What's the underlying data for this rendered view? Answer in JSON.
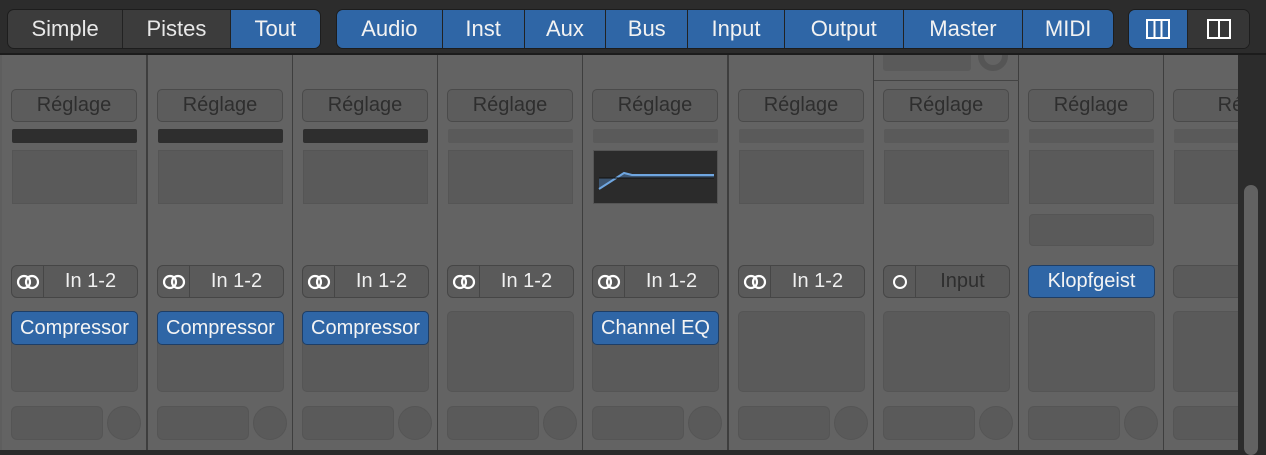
{
  "view_modes": [
    {
      "label": "Simple",
      "active": false
    },
    {
      "label": "Pistes",
      "active": false
    },
    {
      "label": "Tout",
      "active": true
    }
  ],
  "filters": [
    {
      "label": "Audio"
    },
    {
      "label": "Inst"
    },
    {
      "label": "Aux"
    },
    {
      "label": "Bus"
    },
    {
      "label": "Input"
    },
    {
      "label": "Output"
    },
    {
      "label": "Master"
    },
    {
      "label": "MIDI"
    }
  ],
  "layout_buttons": [
    {
      "icon": "wide-columns-icon",
      "active": true
    },
    {
      "icon": "narrow-columns-icon",
      "active": false
    }
  ],
  "strips": [
    {
      "setting": "Réglage",
      "input": "In 1-2",
      "input_icon": "stereo-icon",
      "plugin": "Compressor",
      "dark_bar": true
    },
    {
      "setting": "Réglage",
      "input": "In 1-2",
      "input_icon": "stereo-icon",
      "plugin": "Compressor",
      "dark_bar": true
    },
    {
      "setting": "Réglage",
      "input": "In 1-2",
      "input_icon": "stereo-icon",
      "plugin": "Compressor",
      "dark_bar": true
    },
    {
      "setting": "Réglage",
      "input": "In 1-2",
      "input_icon": "stereo-icon",
      "plugin": null
    },
    {
      "setting": "Réglage",
      "input": "In 1-2",
      "input_icon": "stereo-icon",
      "plugin": "Channel EQ",
      "eq": true
    },
    {
      "setting": "Réglage",
      "input": "In 1-2",
      "input_icon": "stereo-icon",
      "plugin": null
    },
    {
      "setting": "Réglage",
      "input": "Input",
      "input_icon": "mono-icon",
      "plugin": null,
      "dim_input": true
    },
    {
      "setting": "Réglage",
      "input": "Klopfgeist",
      "instrument": true,
      "plugin": null
    },
    {
      "setting": "Rég",
      "input": "",
      "plugin": null
    }
  ]
}
